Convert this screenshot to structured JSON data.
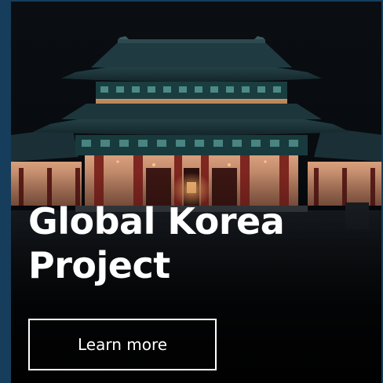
{
  "card": {
    "title_line1": "Global Korea",
    "title_line2": "Project",
    "cta_label": "Learn more",
    "image_subject": "korean-palace-gate-at-night"
  },
  "colors": {
    "frame": "#173d5c",
    "text": "#ffffff",
    "button_border": "#ffffff",
    "roof": "#1e3a40",
    "pillar": "#8a2a22",
    "wall": "#c98f6f",
    "sky": "#07090c"
  }
}
